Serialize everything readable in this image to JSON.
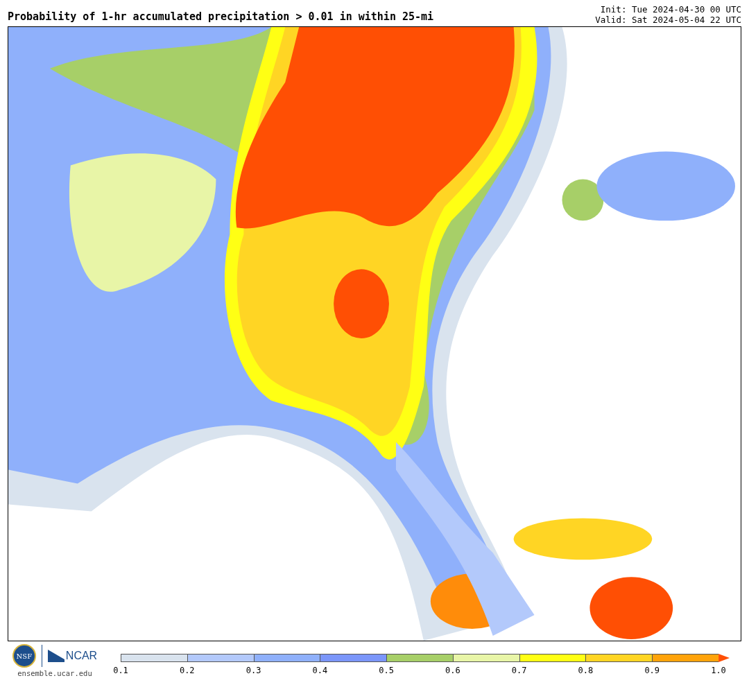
{
  "title": "Probability of 1-hr accumulated precipitation > 0.01 in within 25-mi",
  "init": "Init: Tue 2024-04-30 00 UTC",
  "valid": "Valid: Sat 2024-05-04 22 UTC",
  "logos": {
    "nsf": "NSF",
    "ncar": "NCAR",
    "site": "ensemble.ucar.edu"
  },
  "colorbar": {
    "segments": [
      {
        "color": "#d9e3ee"
      },
      {
        "color": "#b3c9fb"
      },
      {
        "color": "#8fb0fb"
      },
      {
        "color": "#7b96fa"
      },
      {
        "color": "#a7cf68"
      },
      {
        "color": "#e8f5a7"
      },
      {
        "color": "#ffff14"
      },
      {
        "color": "#ffd524"
      },
      {
        "color": "#ffa30a"
      }
    ],
    "extension": {
      "color": "#ff4f04"
    },
    "ticks": [
      "0.1",
      "0.2",
      "0.3",
      "0.4",
      "0.5",
      "0.6",
      "0.7",
      "0.8",
      "0.9",
      "1.0"
    ]
  }
}
